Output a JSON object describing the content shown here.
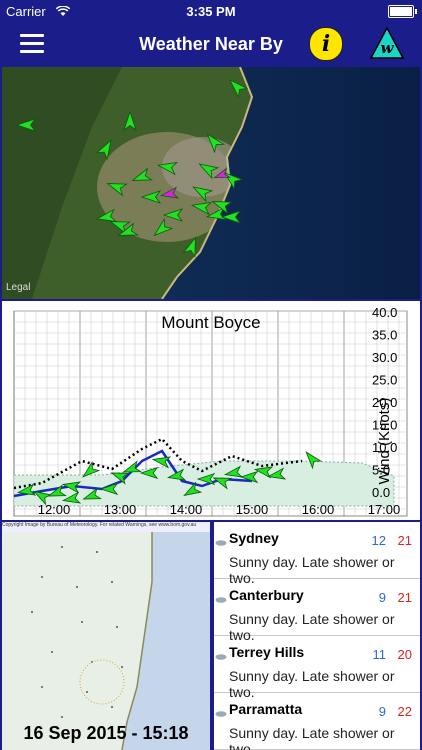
{
  "status": {
    "carrier": "Carrier",
    "time": "3:35 PM"
  },
  "nav": {
    "title": "Weather Near By",
    "info_glyph": "i",
    "logo_letter": "w"
  },
  "map": {
    "legal": "Legal"
  },
  "wind_chart": {
    "title": "Mount Boyce",
    "ylabel": "Wind (Knots)",
    "yticks": [
      "40.0",
      "35.0",
      "30.0",
      "25.0",
      "20.0",
      "15.0",
      "10.0",
      "5.0",
      "0.0"
    ],
    "xticks": [
      "12:00",
      "13:00",
      "14:00",
      "15:00",
      "16:00",
      "17:00"
    ]
  },
  "radar": {
    "caption": "Copyright Image by Bureau of Meteorology. For related Warnings, see www.bom.gov.au",
    "timestamp": "16 Sep 2015 - 15:18"
  },
  "forecast": [
    {
      "name": "Sydney",
      "min": "12",
      "max": "21",
      "desc": "Sunny day. Late shower or two."
    },
    {
      "name": "Canterbury",
      "min": "9",
      "max": "21",
      "desc": "Sunny day. Late shower or two."
    },
    {
      "name": "Terrey Hills",
      "min": "11",
      "max": "20",
      "desc": "Sunny day. Late shower or two."
    },
    {
      "name": "Parramatta",
      "min": "9",
      "max": "22",
      "desc": "Sunny day. Late shower or two."
    }
  ],
  "colors": {
    "nav_bg": "#1b1e8a",
    "arrow": "#22e022",
    "arrow_highlight": "#e020e0",
    "min_temp": "#2d6bd6",
    "max_temp": "#d22222"
  }
}
